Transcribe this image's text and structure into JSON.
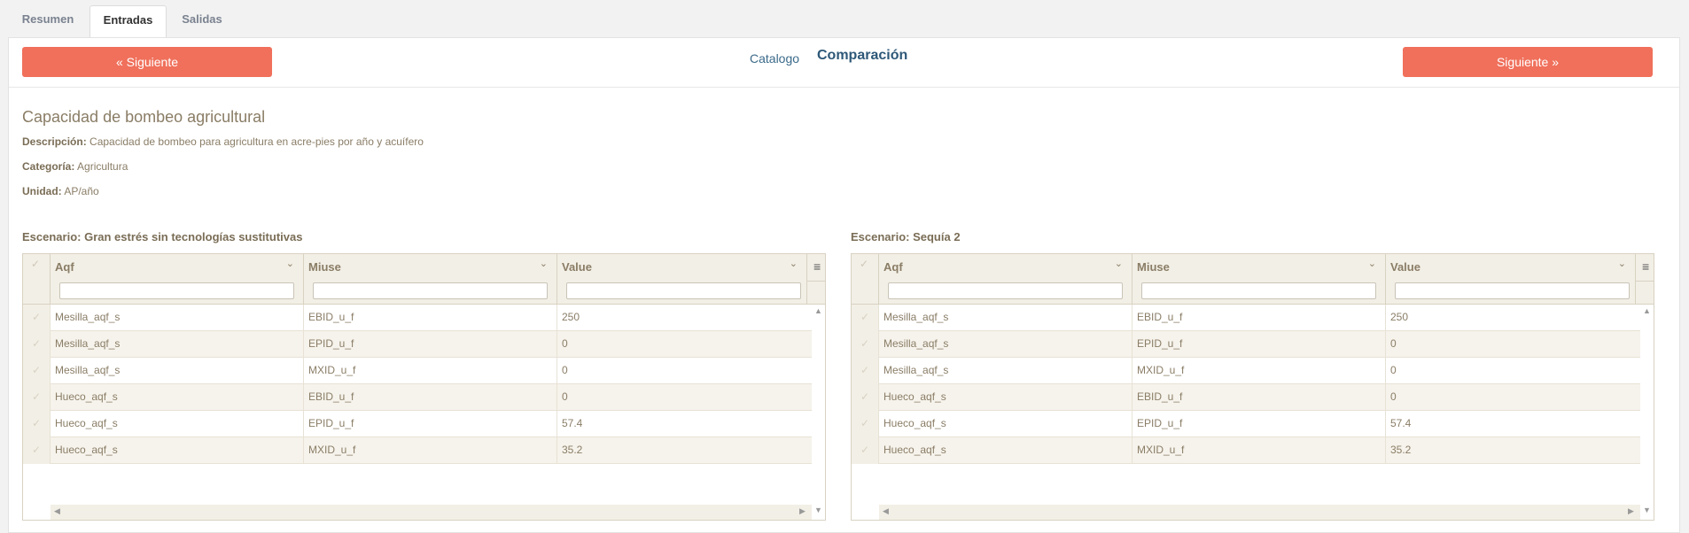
{
  "tabs": {
    "resumen": "Resumen",
    "entradas": "Entradas",
    "salidas": "Salidas"
  },
  "nav": {
    "prev_label": "« Siguiente",
    "next_label": "Siguiente »",
    "catalog_label": "Catalogo",
    "comparison_label": "Comparación"
  },
  "meta": {
    "title": "Capacidad de bombeo agricultural",
    "desc_label": "Descripción:",
    "desc_value": "Capacidad de bombeo para agricultura en acre-pies por año y acuífero",
    "cat_label": "Categoría:",
    "cat_value": "Agricultura",
    "unit_label": "Unidad:",
    "unit_value": "AP/año"
  },
  "grids": {
    "left": {
      "title": "Escenario: Gran estrés sin tecnologías sustitutivas",
      "columns": [
        "Aqf",
        "Miuse",
        "Value"
      ],
      "rows": [
        [
          "Mesilla_aqf_s",
          "EBID_u_f",
          "250"
        ],
        [
          "Mesilla_aqf_s",
          "EPID_u_f",
          "0"
        ],
        [
          "Mesilla_aqf_s",
          "MXID_u_f",
          "0"
        ],
        [
          "Hueco_aqf_s",
          "EBID_u_f",
          "0"
        ],
        [
          "Hueco_aqf_s",
          "EPID_u_f",
          "57.4"
        ],
        [
          "Hueco_aqf_s",
          "MXID_u_f",
          "35.2"
        ]
      ]
    },
    "right": {
      "title": "Escenario: Sequía 2",
      "columns": [
        "Aqf",
        "Miuse",
        "Value"
      ],
      "rows": [
        [
          "Mesilla_aqf_s",
          "EBID_u_f",
          "250"
        ],
        [
          "Mesilla_aqf_s",
          "EPID_u_f",
          "0"
        ],
        [
          "Mesilla_aqf_s",
          "MXID_u_f",
          "0"
        ],
        [
          "Hueco_aqf_s",
          "EBID_u_f",
          "0"
        ],
        [
          "Hueco_aqf_s",
          "EPID_u_f",
          "57.4"
        ],
        [
          "Hueco_aqf_s",
          "MXID_u_f",
          "35.2"
        ]
      ]
    }
  },
  "icons": {
    "check": "✓",
    "caret": "⌄",
    "menu": "≡",
    "up": "▲",
    "down": "▼",
    "left": "◀",
    "right": "▶"
  },
  "colors": {
    "accent_button": "#f0705b",
    "link_blue": "#2e5878"
  }
}
